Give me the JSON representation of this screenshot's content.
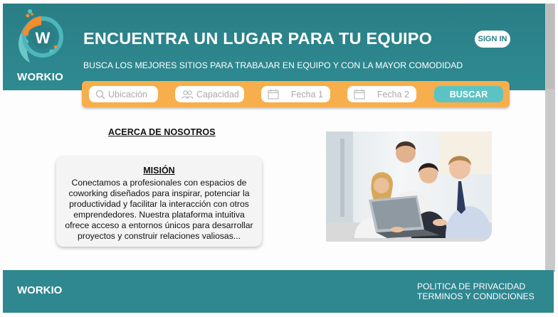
{
  "brand": {
    "name": "WORKIO",
    "logo_letter": "W"
  },
  "header": {
    "title": "ENCUENTRA UN LUGAR PARA TU EQUIPO",
    "subtitle": "BUSCA LOS MEJORES SITIOS PARA TRABAJAR EN EQUIPO Y CON LA MAYOR COMODIDAD",
    "signin_label": "SIGN IN"
  },
  "search": {
    "location_placeholder": "Ubicación",
    "capacity_placeholder": "Capacidad",
    "date1_placeholder": "Fecha 1",
    "date2_placeholder": "Fecha 2",
    "button_label": "BUSCAR"
  },
  "about": {
    "title": "ACERCA DE NOSOTROS",
    "mission_title": "MISIÓN",
    "mission_text": "Conectamos a profesionales con espacios de coworking diseñados para inspirar, potenciar la productividad y facilitar la interacción con otros emprendedores. Nuestra plataforma intuitiva ofrece acceso a entornos únicos para desarrollar proyectos y construir relaciones valiosas..."
  },
  "footer": {
    "brand": "WORKIO",
    "privacy_label": "POLITICA DE PRIVACIDAD",
    "terms_label": "TERMINOS Y CONDICIONES"
  },
  "colors": {
    "header_teal": "#2a7e86",
    "accent_orange": "#f7ae4c",
    "button_teal": "#5cc3c5",
    "footer_teal": "#2f8790"
  },
  "icons": [
    "workio-logo",
    "search-icon",
    "people-icon",
    "calendar-icon"
  ]
}
